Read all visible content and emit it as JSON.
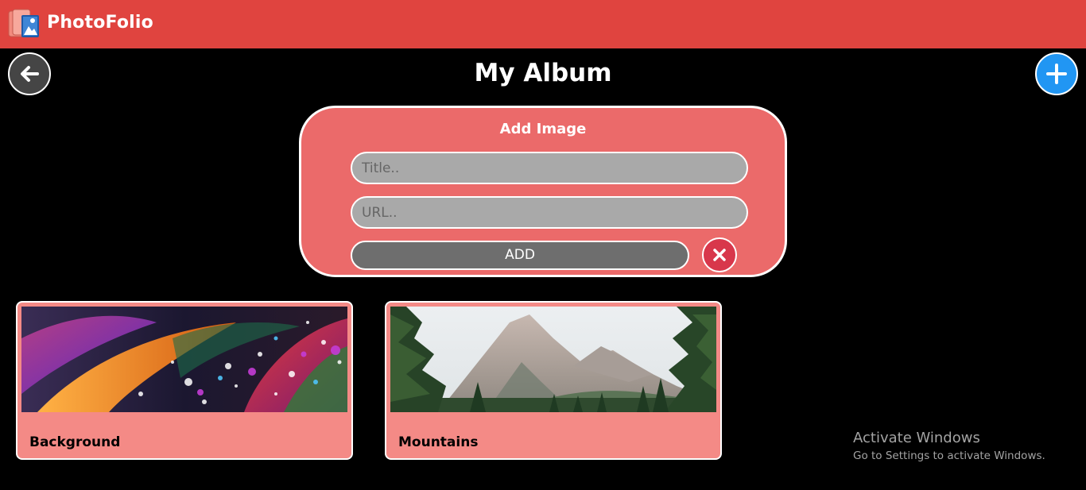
{
  "navbar": {
    "app_name": "PhotoFolio",
    "logo_icon": "photo-album-icon",
    "color": "#e0443f"
  },
  "header": {
    "title": "My Album",
    "back_icon": "arrow-left-icon",
    "add_icon": "plus-icon"
  },
  "image_form": {
    "title": "Add Image",
    "title_placeholder": "Title..",
    "url_placeholder": "URL..",
    "submit_label": "ADD",
    "close_icon": "close-icon"
  },
  "images": [
    {
      "caption": "Background"
    },
    {
      "caption": "Mountains"
    }
  ],
  "watermark": {
    "title": "Activate Windows",
    "subtitle": "Go to Settings to activate Windows."
  },
  "colors": {
    "accent": "#e0443f",
    "form_bg": "#eb6a6a",
    "card_bg": "#f48a86",
    "add_button": "#2196f3",
    "close_button": "#d8374b"
  }
}
